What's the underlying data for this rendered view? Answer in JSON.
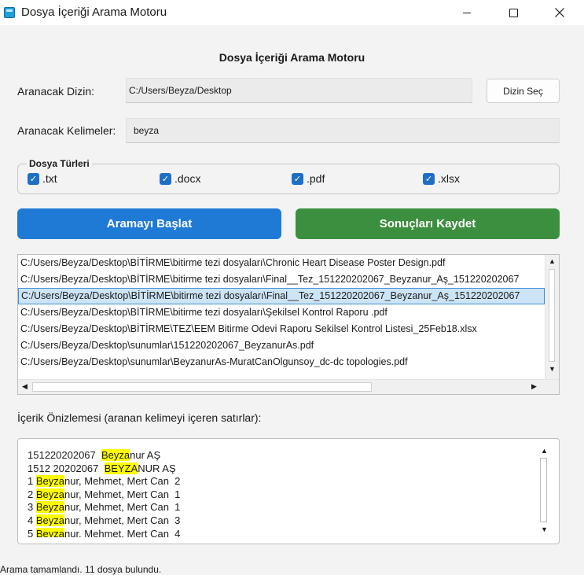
{
  "window": {
    "title": "Dosya İçeriği Arama Motoru"
  },
  "header": {
    "title": "Dosya İçeriği Arama Motoru"
  },
  "directory": {
    "label": "Aranacak Dizin:",
    "value": "C:/Users/Beyza/Desktop",
    "select_button": "Dizin Seç"
  },
  "keywords": {
    "label": "Aranacak Kelimeler:",
    "value": "beyza"
  },
  "file_types": {
    "legend": "Dosya Türleri",
    "options": [
      {
        "label": ".txt",
        "checked": true
      },
      {
        "label": ".docx",
        "checked": true
      },
      {
        "label": ".pdf",
        "checked": true
      },
      {
        "label": ".xlsx",
        "checked": true
      }
    ]
  },
  "actions": {
    "start_label": "Aramayı Başlat",
    "start_color": "#1f7ad6",
    "save_label": "Sonuçları Kaydet",
    "save_color": "#3b8f3e"
  },
  "results": {
    "items": [
      "C:/Users/Beyza/Desktop\\BİTİRME\\bitirme tezi dosyaları\\Chronic Heart Disease Poster Design.pdf",
      "C:/Users/Beyza/Desktop\\BİTİRME\\bitirme tezi dosyaları\\Final__Tez_151220202067_Beyzanur_Aş_151220202067",
      "C:/Users/Beyza/Desktop\\BİTİRME\\bitirme tezi dosyaları\\Final__Tez_151220202067_Beyzanur_Aş_151220202067",
      "C:/Users/Beyza/Desktop\\BİTİRME\\bitirme tezi dosyaları\\Şekilsel Kontrol Raporu .pdf",
      "C:/Users/Beyza/Desktop\\BİTİRME\\TEZ\\EEM Bitirme Odevi Raporu Sekilsel Kontrol Listesi_25Feb18.xlsx",
      "C:/Users/Beyza/Desktop\\sunumlar\\151220202067_BeyzanurAs.pdf",
      "C:/Users/Beyza/Desktop\\sunumlar\\BeyzanurAs-MuratCanOlgunsoy_dc-dc topologies.pdf"
    ],
    "selected_index": 2
  },
  "preview": {
    "label": "İçerik Önizlemesi (aranan kelimeyi içeren satırlar):",
    "lines": [
      {
        "pre": "151220202067  ",
        "hit": "Beyza",
        "post": "nur AŞ"
      },
      {
        "pre": "1512 20202067  ",
        "hit": "BEYZA",
        "post": "NUR AŞ"
      },
      {
        "pre": "1 ",
        "hit": "Beyza",
        "post": "nur, Mehmet, Mert Can  2"
      },
      {
        "pre": "2 ",
        "hit": "Beyza",
        "post": "nur, Mehmet, Mert Can  1"
      },
      {
        "pre": "3 ",
        "hit": "Beyza",
        "post": "nur, Mehmet, Mert Can  1"
      },
      {
        "pre": "4 ",
        "hit": "Beyza",
        "post": "nur, Mehmet, Mert Can  3"
      },
      {
        "pre": "5 ",
        "hit": "Beyza",
        "post": "nur, Mehmet, Mert Can  4"
      }
    ],
    "highlight_color": "#ffff00"
  },
  "status": {
    "text": "Arama tamamlandı. 11 dosya bulundu."
  }
}
